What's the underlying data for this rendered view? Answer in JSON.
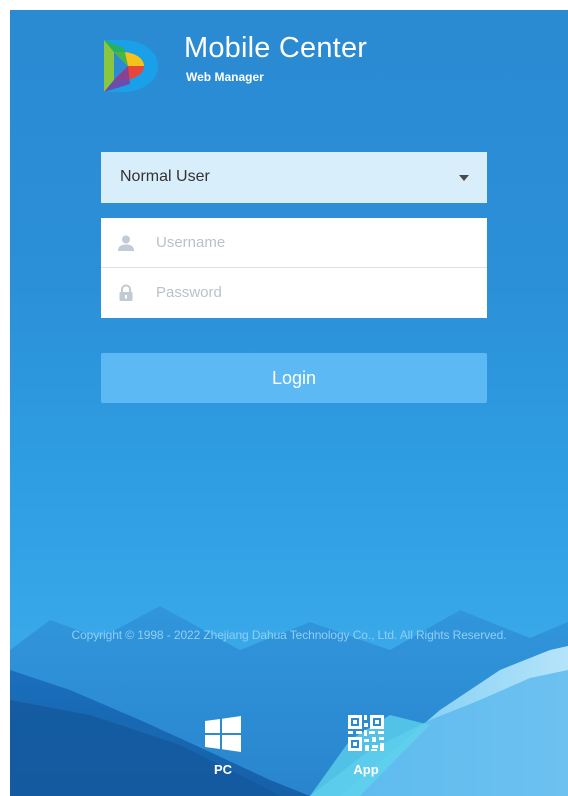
{
  "brand": {
    "title": "Mobile Center",
    "subtitle": "Web Manager",
    "logo_icon": "dahua-d-logo-icon"
  },
  "login_form": {
    "user_type": {
      "selected": "Normal User",
      "caret_icon": "caret-down-icon"
    },
    "username": {
      "placeholder": "Username",
      "value": "",
      "icon": "user-icon"
    },
    "password": {
      "placeholder": "Password",
      "value": "",
      "icon": "lock-icon"
    },
    "login_label": "Login"
  },
  "footer": {
    "copyright": "Copyright © 1998 - 2022 Zhejiang Dahua Technology Co., Ltd. All Rights Reserved.",
    "downloads": [
      {
        "label": "PC",
        "icon": "windows-icon"
      },
      {
        "label": "App",
        "icon": "qr-code-icon"
      }
    ]
  },
  "colors": {
    "background": "#2b90d8",
    "select_bg": "#d9eefb",
    "login_button": "#5db9f4",
    "copyright_text": "#8fcff7"
  }
}
